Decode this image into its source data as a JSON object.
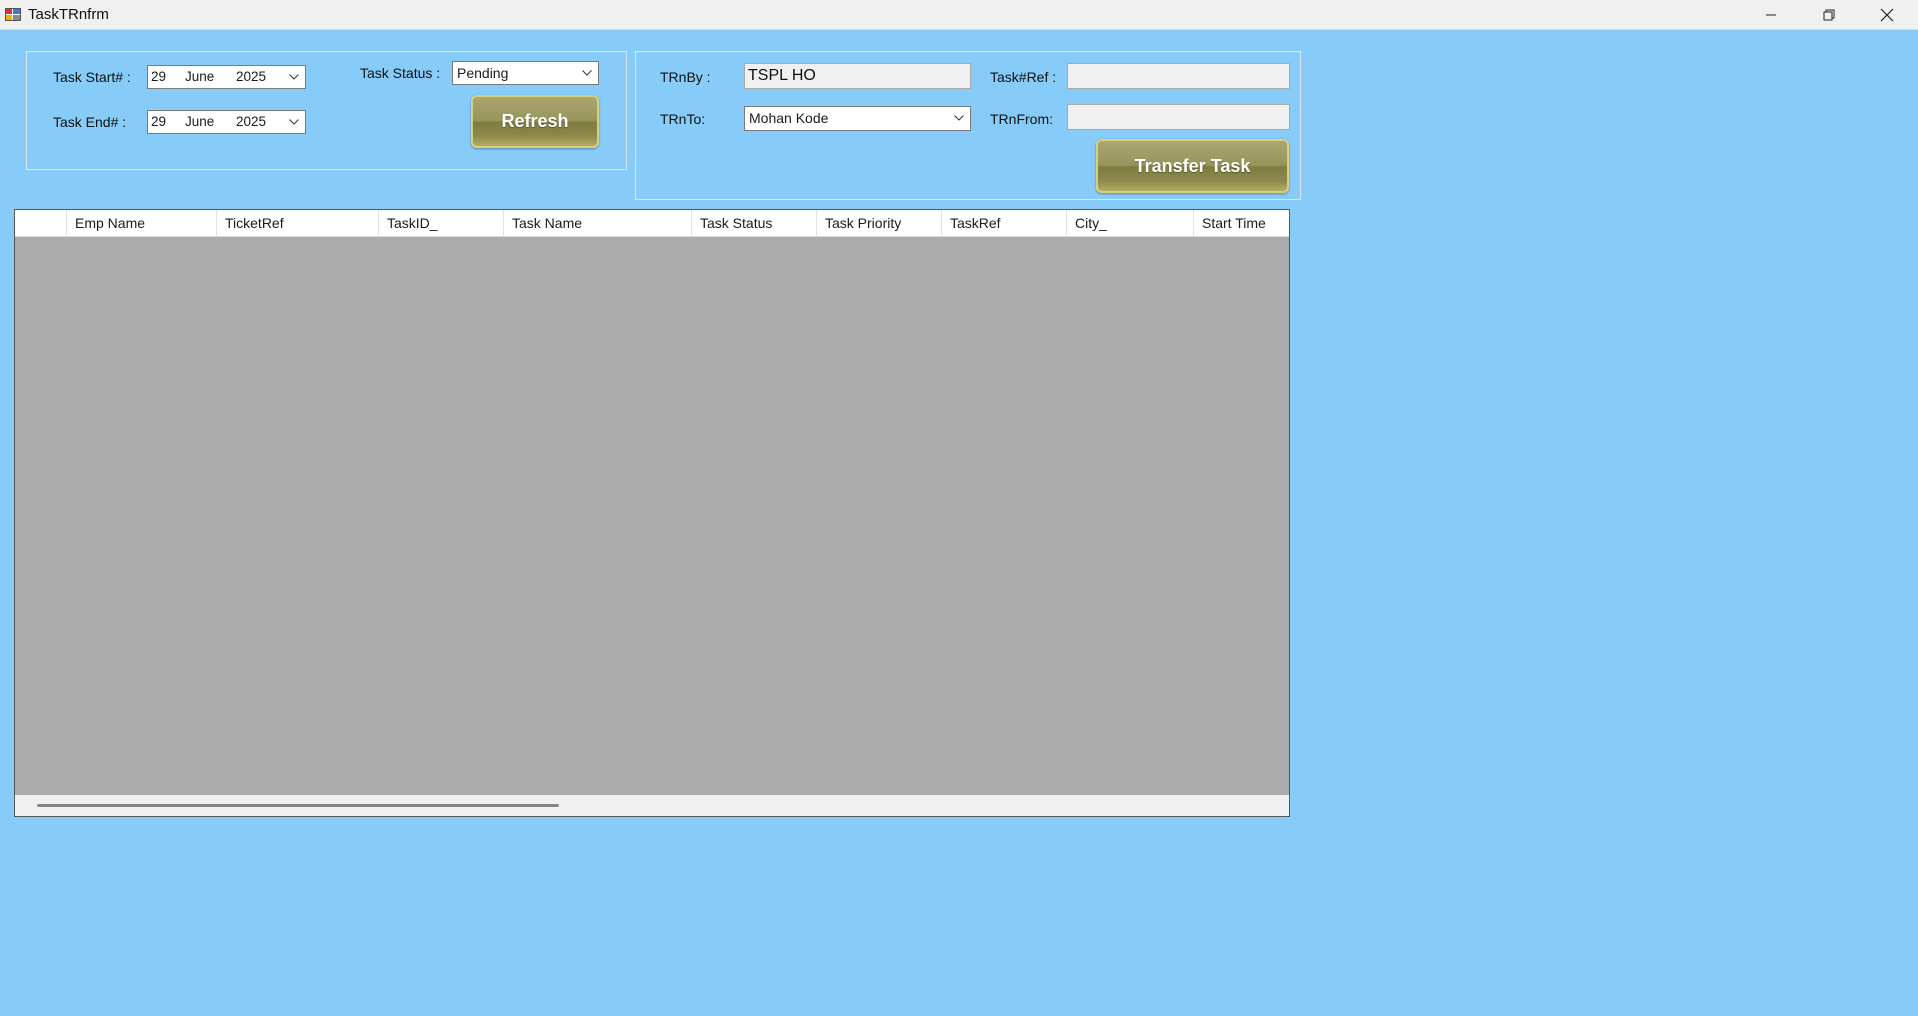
{
  "window": {
    "title": "TaskTRnfrm",
    "controls": {
      "minimize": "minimize",
      "maximize": "restore",
      "close": "close"
    }
  },
  "filters": {
    "task_start_label": "Task Start# :",
    "task_end_label": "Task End# :",
    "task_start": {
      "day": "29",
      "month": "June",
      "year": "2025"
    },
    "task_end": {
      "day": "29",
      "month": "June",
      "year": "2025"
    },
    "task_status_label": "Task Status :",
    "task_status_value": "Pending",
    "refresh_label": "Refresh"
  },
  "transfer": {
    "trnby_label": "TRnBy :",
    "trnby_value": "TSPL HO",
    "trnto_label": "TRnTo:",
    "trnto_value": "Mohan Kode",
    "taskref_label": "Task#Ref :",
    "taskref_value": "",
    "trnfrom_label": "TRnFrom:",
    "trnfrom_value": "",
    "transfer_button": "Transfer Task"
  },
  "grid": {
    "columns": [
      "Emp Name",
      "TicketRef",
      "TaskID_",
      "Task Name",
      "Task Status",
      "Task Priority",
      "TaskRef",
      "City_",
      "Start Time"
    ],
    "rows": []
  },
  "colors": {
    "background": "#87cbf9",
    "grid_background": "#ababab",
    "button_olive": "#8c8a4c"
  }
}
